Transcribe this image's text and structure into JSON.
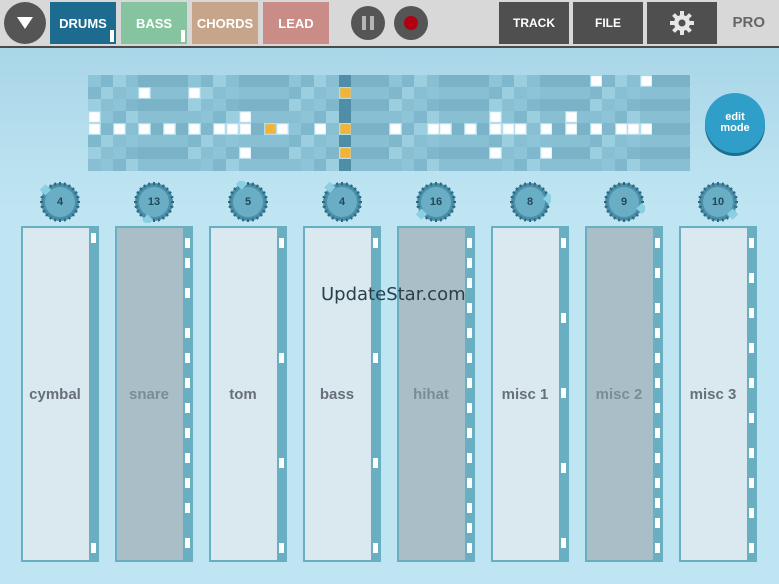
{
  "topbar": {
    "menu_icon": "chevron-down-icon",
    "tabs": [
      {
        "label": "DRUMS",
        "color": "#1d6c8f"
      },
      {
        "label": "BASS",
        "color": "#85c49e"
      },
      {
        "label": "CHORDS",
        "color": "#c6a58b"
      },
      {
        "label": "LEAD",
        "color": "#c98c86"
      }
    ],
    "pause_icon": "pause-icon",
    "record_icon": "record-icon",
    "track_label": "TRACK",
    "file_label": "FILE",
    "settings_icon": "gear-icon",
    "pro_label": "PRO"
  },
  "sequencer": {
    "rows": 8,
    "cols": 48,
    "playhead_col": 20,
    "active_cells": [
      [
        0,
        40
      ],
      [
        0,
        44
      ],
      [
        1,
        4
      ],
      [
        1,
        8
      ],
      [
        3,
        0
      ],
      [
        3,
        12
      ],
      [
        3,
        32
      ],
      [
        3,
        38
      ],
      [
        4,
        0
      ],
      [
        4,
        2
      ],
      [
        4,
        4
      ],
      [
        4,
        6
      ],
      [
        4,
        8
      ],
      [
        4,
        10
      ],
      [
        4,
        11
      ],
      [
        4,
        12
      ],
      [
        4,
        15
      ],
      [
        4,
        18
      ],
      [
        4,
        20
      ],
      [
        4,
        24
      ],
      [
        4,
        27
      ],
      [
        4,
        28
      ],
      [
        4,
        30
      ],
      [
        4,
        32
      ],
      [
        4,
        33
      ],
      [
        4,
        34
      ],
      [
        4,
        36
      ],
      [
        4,
        38
      ],
      [
        4,
        40
      ],
      [
        4,
        42
      ],
      [
        4,
        43
      ],
      [
        4,
        44
      ],
      [
        6,
        12
      ],
      [
        6,
        20
      ],
      [
        6,
        32
      ],
      [
        6,
        36
      ]
    ],
    "highlight_cells": [
      [
        1,
        20
      ],
      [
        4,
        14
      ],
      [
        4,
        20
      ],
      [
        6,
        20
      ]
    ]
  },
  "edit_mode": {
    "line1": "edit",
    "line2": "mode"
  },
  "channels": [
    {
      "name": "cymbal",
      "knob": "4"
    },
    {
      "name": "snare",
      "knob": "13"
    },
    {
      "name": "tom",
      "knob": "5"
    },
    {
      "name": "bass",
      "knob": "4"
    },
    {
      "name": "hihat",
      "knob": "16"
    },
    {
      "name": "misc 1",
      "knob": "8"
    },
    {
      "name": "misc 2",
      "knob": "9"
    },
    {
      "name": "misc 3",
      "knob": "10"
    }
  ],
  "watermark": "UpdateStar.com"
}
